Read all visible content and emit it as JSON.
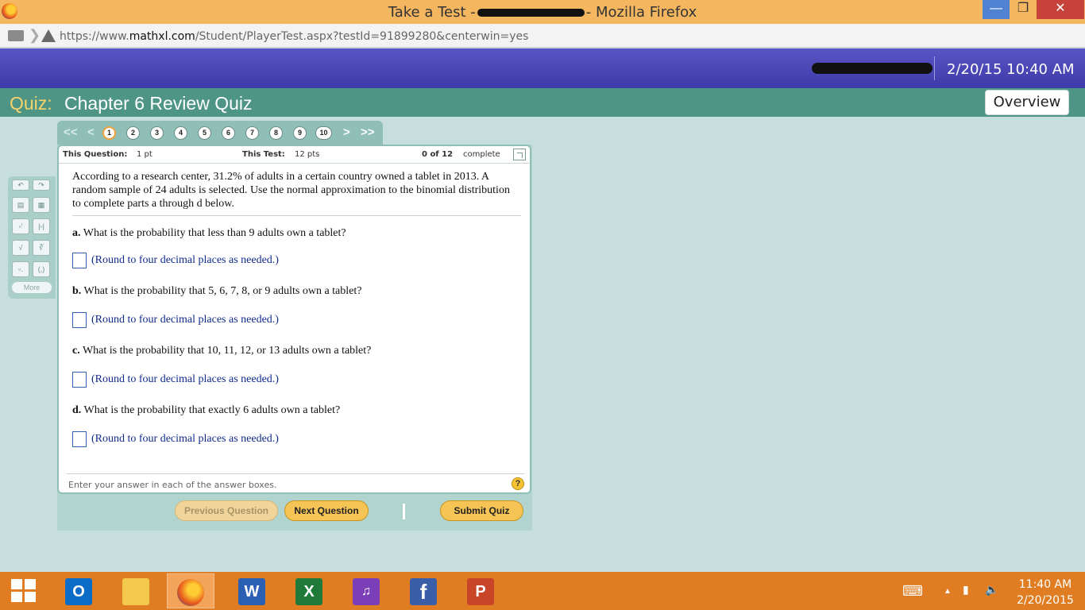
{
  "browser": {
    "title_prefix": "Take a Test -",
    "title_suffix": "- Mozilla Firefox",
    "url_prefix": "https://www.",
    "url_domain": "mathxl.com",
    "url_path": "/Student/PlayerTest.aspx?testId=91899280&centerwin=yes"
  },
  "header": {
    "datetime": "2/20/15 10:40 AM"
  },
  "quiz": {
    "label": "Quiz:",
    "name": "Chapter 6 Review Quiz",
    "overview_label": "Overview"
  },
  "nav": {
    "first": "<<",
    "prev": "<",
    "next": ">",
    "last": ">>",
    "questions": [
      "1",
      "2",
      "3",
      "4",
      "5",
      "6",
      "7",
      "8",
      "9",
      "10"
    ],
    "current": "1"
  },
  "info": {
    "this_question_label": "This Question:",
    "this_question_value": "1 pt",
    "this_test_label": "This Test:",
    "this_test_value": "12 pts",
    "progress": "0 of 12",
    "progress_suffix": "complete"
  },
  "tools": {
    "more_label": "More"
  },
  "question": {
    "intro": "According to a research center, 31.2% of adults in a certain country owned a tablet in 2013. A random sample of 24 adults is selected. Use the normal approximation to the binomial distribution to complete parts a through d below.",
    "parts": [
      {
        "letter": "a.",
        "text": "What is the probability that less than 9 adults own a tablet?",
        "hint": "(Round to four decimal places as needed.)",
        "value": ""
      },
      {
        "letter": "b.",
        "text": "What is the probability that 5, 6, 7, 8, or 9 adults own a tablet?",
        "hint": "(Round to four decimal places as needed.)",
        "value": ""
      },
      {
        "letter": "c.",
        "text": "What is the probability that 10, 11, 12, or 13 adults own a tablet?",
        "hint": "(Round to four decimal places as needed.)",
        "value": ""
      },
      {
        "letter": "d.",
        "text": "What is the probability that exactly 6 adults own a tablet?",
        "hint": "(Round to four decimal places as needed.)",
        "value": ""
      }
    ],
    "footer": "Enter your answer in each of the answer boxes.",
    "help": "?"
  },
  "buttons": {
    "previous": "Previous Question",
    "next": "Next Question",
    "submit": "Submit Quiz"
  },
  "taskbar": {
    "time": "11:40 AM",
    "date": "2/20/2015",
    "apps": [
      "outlook-icon",
      "file-explorer-icon",
      "firefox-icon",
      "word-icon",
      "excel-icon",
      "video-editor-icon",
      "facebook-icon",
      "powerpoint-icon"
    ]
  },
  "colors": {
    "header_purple": "#4a46b6",
    "quizbar_teal": "#4f9586",
    "accent_yellow": "#f6c455",
    "taskbar_orange": "#e07d22"
  }
}
